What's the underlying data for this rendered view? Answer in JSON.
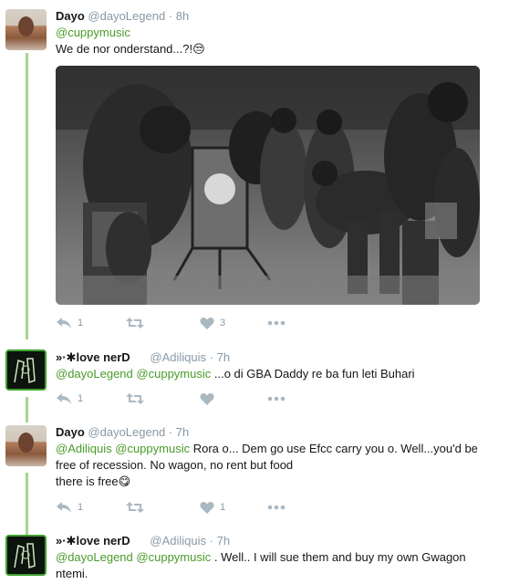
{
  "tweets": [
    {
      "name": "Dayo",
      "handle": "@dayoLegend",
      "dot": "·",
      "time": "8h",
      "mention1": "@cuppymusic",
      "line1": "We de nor onderstand...?!",
      "emoji1": "😒",
      "reply_count": "1",
      "retweet_count": "",
      "like_count": "3"
    },
    {
      "name": "»·✱love nerD",
      "handle": "@Adiliquis",
      "dot": "·",
      "time": "7h",
      "mention1": "@dayoLegend",
      "mention2": "@cuppymusic",
      "body": " ...o di GBA Daddy re ba fun leti Buhari",
      "reply_count": "1",
      "retweet_count": "",
      "like_count": ""
    },
    {
      "name": "Dayo",
      "handle": "@dayoLegend",
      "dot": "·",
      "time": "7h",
      "mention1": "@Adiliquis",
      "mention2": "@cuppymusic",
      "body": " Rora o... Dem go use Efcc carry you o. Well...you'd be free of recession. No wagon, no rent but food",
      "line2": " there is free",
      "emoji1": "😋",
      "reply_count": "1",
      "retweet_count": "",
      "like_count": "1"
    },
    {
      "name": "»·✱love nerD",
      "handle": "@Adiliquis",
      "dot": "·",
      "time": "7h",
      "mention1": "@dayoLegend",
      "mention2": "@cuppymusic",
      "body": " . Well.. I will sue them and buy my own Gwagon ntemi."
    }
  ],
  "icons": {
    "reply": "reply-icon",
    "retweet": "retweet-icon",
    "like": "heart-icon",
    "more": "more-icon"
  },
  "colors": {
    "mention": "#4a9b2a",
    "thread_line": "#a8d48a",
    "meta": "#8899a6",
    "action_icon": "#aab8c2"
  }
}
